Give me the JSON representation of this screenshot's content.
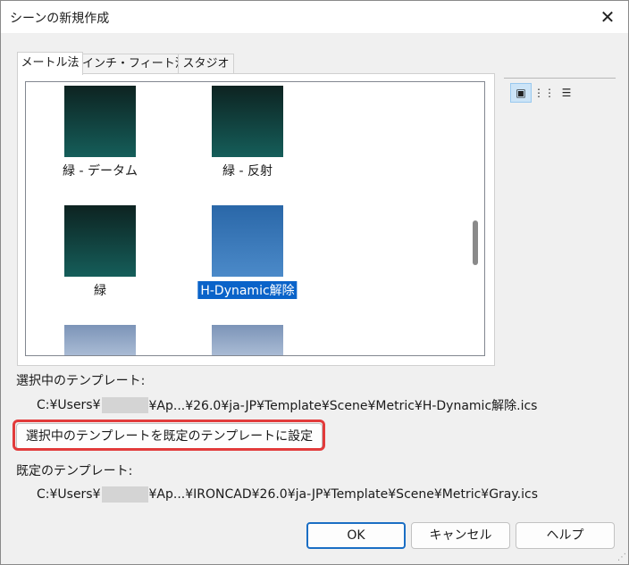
{
  "window": {
    "title": "シーンの新規作成",
    "close_label": "✕"
  },
  "tabs": [
    {
      "label": "メートル法",
      "active": true
    },
    {
      "label": "インチ・フィート法",
      "active": false
    },
    {
      "label": "スタジオ",
      "active": false
    }
  ],
  "templates": [
    {
      "label": "緑 - データム",
      "style": "dark"
    },
    {
      "label": "緑 - 反射",
      "style": "dark"
    },
    {
      "label": "緑",
      "style": "dark"
    },
    {
      "label": "H-Dynamic解除",
      "style": "blue",
      "selected": true
    }
  ],
  "view_buttons": [
    {
      "icon": "large-icons-view-icon",
      "glyph": "▣",
      "active": true
    },
    {
      "icon": "small-icons-view-icon",
      "glyph": "⋮⋮",
      "active": false
    },
    {
      "icon": "list-view-icon",
      "glyph": "☰",
      "active": false
    }
  ],
  "selected_template": {
    "label": "選択中のテンプレート:",
    "path_prefix": "C:¥Users¥",
    "path_suffix": "¥Ap...¥26.0¥ja-JP¥Template¥Scene¥Metric¥H-Dynamic解除.ics"
  },
  "set_default_button": "選択中のテンプレートを既定のテンプレートに設定",
  "default_template": {
    "label": "既定のテンプレート:",
    "path_prefix": "C:¥Users¥",
    "path_suffix": "¥Ap...¥IRONCAD¥26.0¥ja-JP¥Template¥Scene¥Metric¥Gray.ics"
  },
  "buttons": {
    "ok": "OK",
    "cancel": "キャンセル",
    "help": "ヘルプ"
  },
  "colors": {
    "accent": "#0a63c9",
    "highlight": "#e23b3b"
  }
}
